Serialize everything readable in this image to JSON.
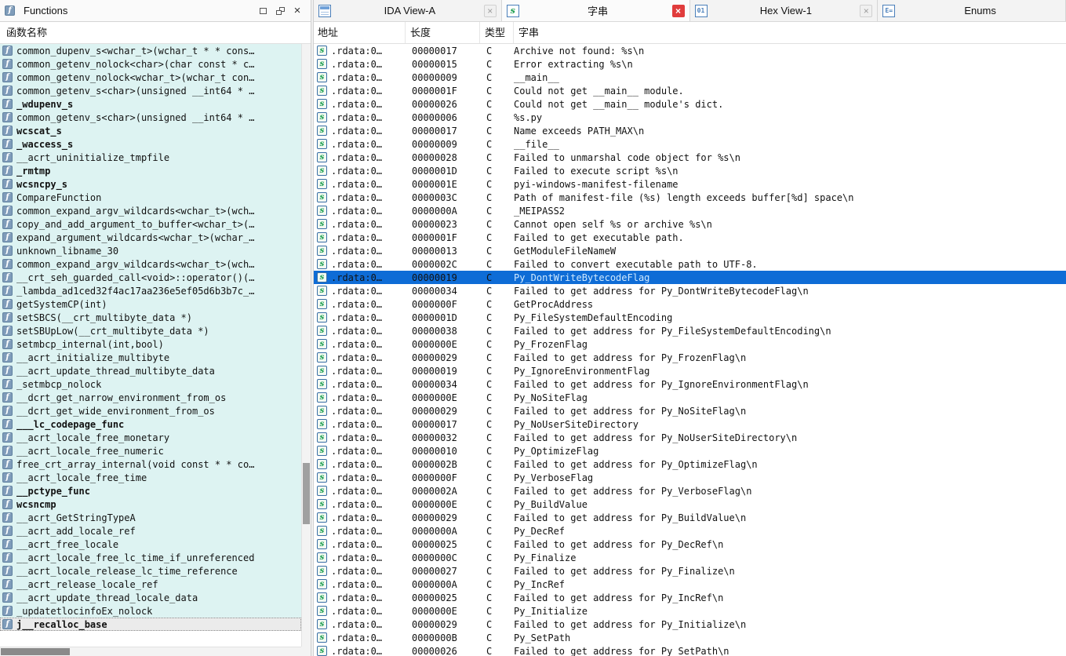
{
  "icons": {
    "function_glyph": "f",
    "string_glyph": "s",
    "close_glyph": "×",
    "hex_glyph": "01",
    "enum_glyph": "E="
  },
  "colors": {
    "selection_blue": "#0e6cd6",
    "library_function_row": "#ddf3f2",
    "selected_function_row": "#ebebeb",
    "active_tab_close_red": "#e03c3c",
    "selected_string_text": "#cfe9ff"
  },
  "functions_panel": {
    "window_title": "Functions",
    "header": "函数名称",
    "items": [
      {
        "label": "common_dupenv_s<wchar_t>(wchar_t * * cons…"
      },
      {
        "label": "common_getenv_nolock<char>(char const * c…"
      },
      {
        "label": "common_getenv_nolock<wchar_t>(wchar_t con…"
      },
      {
        "label": "common_getenv_s<char>(unsigned __int64 * …"
      },
      {
        "label": "_wdupenv_s",
        "bold": true
      },
      {
        "label": "common_getenv_s<char>(unsigned __int64 * …"
      },
      {
        "label": "wcscat_s",
        "bold": true
      },
      {
        "label": "_waccess_s",
        "bold": true
      },
      {
        "label": "__acrt_uninitialize_tmpfile"
      },
      {
        "label": "_rmtmp",
        "bold": true
      },
      {
        "label": "wcsncpy_s",
        "bold": true
      },
      {
        "label": "CompareFunction"
      },
      {
        "label": "common_expand_argv_wildcards<wchar_t>(wch…"
      },
      {
        "label": "copy_and_add_argument_to_buffer<wchar_t>(…"
      },
      {
        "label": "expand_argument_wildcards<wchar_t>(wchar_…"
      },
      {
        "label": "unknown_libname_30"
      },
      {
        "label": "common_expand_argv_wildcards<wchar_t>(wch…"
      },
      {
        "label": "__crt_seh_guarded_call<void>::operator()(…"
      },
      {
        "label": "_lambda_ad1ced32f4ac17aa236e5ef05d6b3b7c_…"
      },
      {
        "label": "getSystemCP(int)"
      },
      {
        "label": "setSBCS(__crt_multibyte_data *)"
      },
      {
        "label": "setSBUpLow(__crt_multibyte_data *)"
      },
      {
        "label": "setmbcp_internal(int,bool)"
      },
      {
        "label": "__acrt_initialize_multibyte"
      },
      {
        "label": "__acrt_update_thread_multibyte_data"
      },
      {
        "label": "_setmbcp_nolock"
      },
      {
        "label": "__dcrt_get_narrow_environment_from_os"
      },
      {
        "label": "__dcrt_get_wide_environment_from_os"
      },
      {
        "label": "___lc_codepage_func",
        "bold": true
      },
      {
        "label": "__acrt_locale_free_monetary"
      },
      {
        "label": "__acrt_locale_free_numeric"
      },
      {
        "label": "free_crt_array_internal(void const * * co…"
      },
      {
        "label": "__acrt_locale_free_time"
      },
      {
        "label": "__pctype_func",
        "bold": true
      },
      {
        "label": "wcsncmp",
        "bold": true
      },
      {
        "label": "__acrt_GetStringTypeA"
      },
      {
        "label": "__acrt_add_locale_ref"
      },
      {
        "label": "__acrt_free_locale"
      },
      {
        "label": "__acrt_locale_free_lc_time_if_unreferenced"
      },
      {
        "label": "__acrt_locale_release_lc_time_reference"
      },
      {
        "label": "__acrt_release_locale_ref"
      },
      {
        "label": "__acrt_update_thread_locale_data"
      },
      {
        "label": "_updatetlocinfoEx_nolock"
      },
      {
        "label": "j__recalloc_base",
        "bold": true,
        "selected": true
      }
    ]
  },
  "tabs": [
    {
      "label": "IDA View-A",
      "active": false,
      "closable": true
    },
    {
      "label": "字串",
      "active": true,
      "closable": true
    },
    {
      "label": "Hex View-1",
      "active": false,
      "closable": true
    },
    {
      "label": "Enums",
      "active": false,
      "closable": false
    }
  ],
  "strings_panel": {
    "columns": [
      "地址",
      "长度",
      "类型",
      "字串"
    ],
    "rows": [
      {
        "address": ".rdata:0…",
        "length": "00000017",
        "type": "C",
        "string": "Archive not found: %s\\n"
      },
      {
        "address": ".rdata:0…",
        "length": "00000015",
        "type": "C",
        "string": "Error extracting %s\\n"
      },
      {
        "address": ".rdata:0…",
        "length": "00000009",
        "type": "C",
        "string": "__main__"
      },
      {
        "address": ".rdata:0…",
        "length": "0000001F",
        "type": "C",
        "string": "Could not get __main__ module."
      },
      {
        "address": ".rdata:0…",
        "length": "00000026",
        "type": "C",
        "string": "Could not get __main__ module's dict."
      },
      {
        "address": ".rdata:0…",
        "length": "00000006",
        "type": "C",
        "string": "%s.py"
      },
      {
        "address": ".rdata:0…",
        "length": "00000017",
        "type": "C",
        "string": "Name exceeds PATH_MAX\\n"
      },
      {
        "address": ".rdata:0…",
        "length": "00000009",
        "type": "C",
        "string": "__file__"
      },
      {
        "address": ".rdata:0…",
        "length": "00000028",
        "type": "C",
        "string": "Failed to unmarshal code object for %s\\n"
      },
      {
        "address": ".rdata:0…",
        "length": "0000001D",
        "type": "C",
        "string": "Failed to execute script %s\\n"
      },
      {
        "address": ".rdata:0…",
        "length": "0000001E",
        "type": "C",
        "string": "pyi-windows-manifest-filename"
      },
      {
        "address": ".rdata:0…",
        "length": "0000003C",
        "type": "C",
        "string": "Path of manifest-file (%s) length exceeds buffer[%d] space\\n"
      },
      {
        "address": ".rdata:0…",
        "length": "0000000A",
        "type": "C",
        "string": "_MEIPASS2"
      },
      {
        "address": ".rdata:0…",
        "length": "00000023",
        "type": "C",
        "string": "Cannot open self %s or archive %s\\n"
      },
      {
        "address": ".rdata:0…",
        "length": "0000001F",
        "type": "C",
        "string": "Failed to get executable path."
      },
      {
        "address": ".rdata:0…",
        "length": "00000013",
        "type": "C",
        "string": "GetModuleFileNameW"
      },
      {
        "address": ".rdata:0…",
        "length": "0000002C",
        "type": "C",
        "string": "Failed to convert executable path to UTF-8."
      },
      {
        "address": ".rdata:0…",
        "length": "00000019",
        "type": "C",
        "string": "Py_DontWriteBytecodeFlag",
        "selected": true
      },
      {
        "address": ".rdata:0…",
        "length": "00000034",
        "type": "C",
        "string": "Failed to get address for Py_DontWriteBytecodeFlag\\n"
      },
      {
        "address": ".rdata:0…",
        "length": "0000000F",
        "type": "C",
        "string": "GetProcAddress"
      },
      {
        "address": ".rdata:0…",
        "length": "0000001D",
        "type": "C",
        "string": "Py_FileSystemDefaultEncoding"
      },
      {
        "address": ".rdata:0…",
        "length": "00000038",
        "type": "C",
        "string": "Failed to get address for Py_FileSystemDefaultEncoding\\n"
      },
      {
        "address": ".rdata:0…",
        "length": "0000000E",
        "type": "C",
        "string": "Py_FrozenFlag"
      },
      {
        "address": ".rdata:0…",
        "length": "00000029",
        "type": "C",
        "string": "Failed to get address for Py_FrozenFlag\\n"
      },
      {
        "address": ".rdata:0…",
        "length": "00000019",
        "type": "C",
        "string": "Py_IgnoreEnvironmentFlag"
      },
      {
        "address": ".rdata:0…",
        "length": "00000034",
        "type": "C",
        "string": "Failed to get address for Py_IgnoreEnvironmentFlag\\n"
      },
      {
        "address": ".rdata:0…",
        "length": "0000000E",
        "type": "C",
        "string": "Py_NoSiteFlag"
      },
      {
        "address": ".rdata:0…",
        "length": "00000029",
        "type": "C",
        "string": "Failed to get address for Py_NoSiteFlag\\n"
      },
      {
        "address": ".rdata:0…",
        "length": "00000017",
        "type": "C",
        "string": "Py_NoUserSiteDirectory"
      },
      {
        "address": ".rdata:0…",
        "length": "00000032",
        "type": "C",
        "string": "Failed to get address for Py_NoUserSiteDirectory\\n"
      },
      {
        "address": ".rdata:0…",
        "length": "00000010",
        "type": "C",
        "string": "Py_OptimizeFlag"
      },
      {
        "address": ".rdata:0…",
        "length": "0000002B",
        "type": "C",
        "string": "Failed to get address for Py_OptimizeFlag\\n"
      },
      {
        "address": ".rdata:0…",
        "length": "0000000F",
        "type": "C",
        "string": "Py_VerboseFlag"
      },
      {
        "address": ".rdata:0…",
        "length": "0000002A",
        "type": "C",
        "string": "Failed to get address for Py_VerboseFlag\\n"
      },
      {
        "address": ".rdata:0…",
        "length": "0000000E",
        "type": "C",
        "string": "Py_BuildValue"
      },
      {
        "address": ".rdata:0…",
        "length": "00000029",
        "type": "C",
        "string": "Failed to get address for Py_BuildValue\\n"
      },
      {
        "address": ".rdata:0…",
        "length": "0000000A",
        "type": "C",
        "string": "Py_DecRef"
      },
      {
        "address": ".rdata:0…",
        "length": "00000025",
        "type": "C",
        "string": "Failed to get address for Py_DecRef\\n"
      },
      {
        "address": ".rdata:0…",
        "length": "0000000C",
        "type": "C",
        "string": "Py_Finalize"
      },
      {
        "address": ".rdata:0…",
        "length": "00000027",
        "type": "C",
        "string": "Failed to get address for Py_Finalize\\n"
      },
      {
        "address": ".rdata:0…",
        "length": "0000000A",
        "type": "C",
        "string": "Py_IncRef"
      },
      {
        "address": ".rdata:0…",
        "length": "00000025",
        "type": "C",
        "string": "Failed to get address for Py_IncRef\\n"
      },
      {
        "address": ".rdata:0…",
        "length": "0000000E",
        "type": "C",
        "string": "Py_Initialize"
      },
      {
        "address": ".rdata:0…",
        "length": "00000029",
        "type": "C",
        "string": "Failed to get address for Py_Initialize\\n"
      },
      {
        "address": ".rdata:0…",
        "length": "0000000B",
        "type": "C",
        "string": "Py_SetPath"
      },
      {
        "address": ".rdata:0…",
        "length": "00000026",
        "type": "C",
        "string": "Failed to get address for Py_SetPath\\n"
      }
    ]
  }
}
